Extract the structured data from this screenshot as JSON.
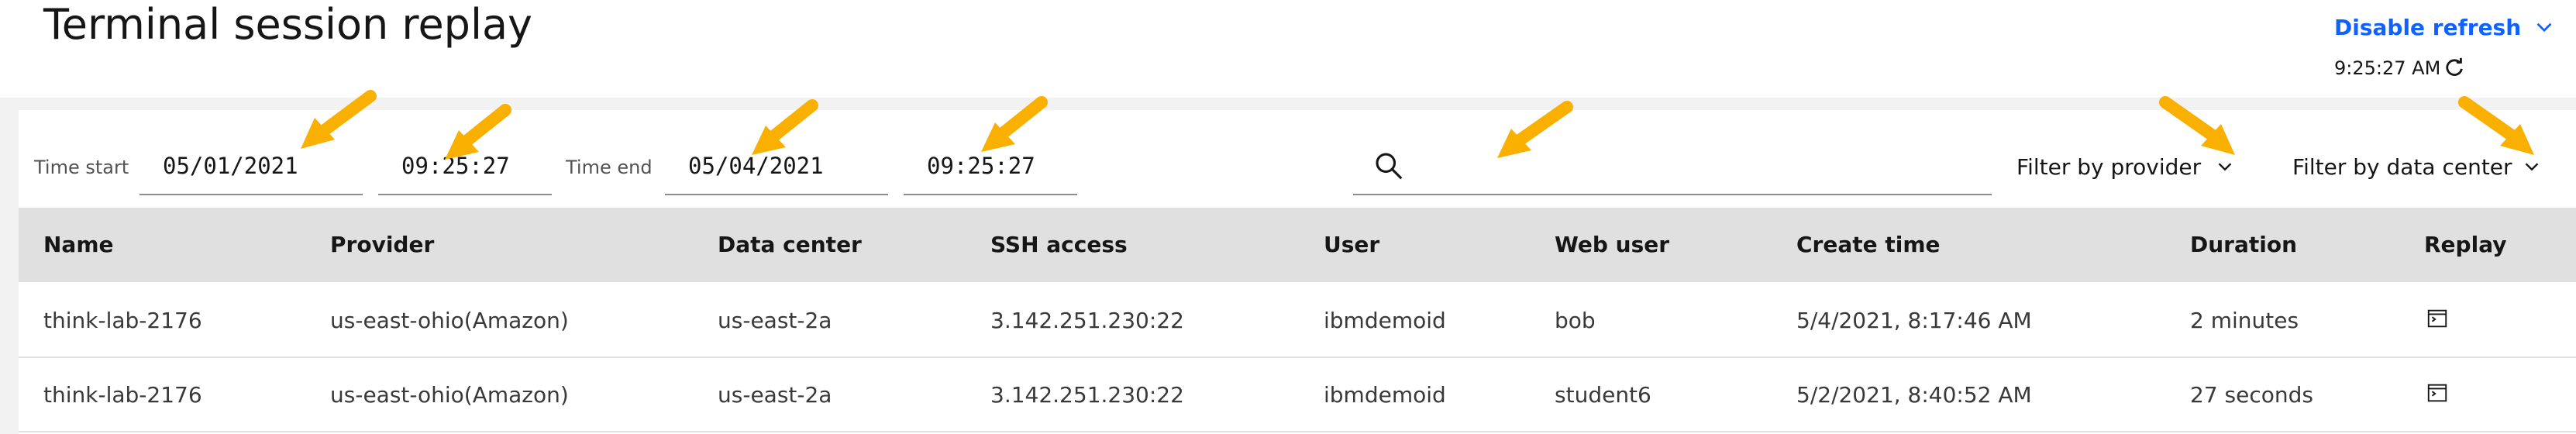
{
  "header": {
    "title": "Terminal session replay",
    "refresh_label": "Disable refresh",
    "last_refresh_time": "9:25:27 AM"
  },
  "filters": {
    "time_start_label": "Time start",
    "time_start_date": "05/01/2021",
    "time_start_time": "09:25:27",
    "time_end_label": "Time end",
    "time_end_date": "05/04/2021",
    "time_end_time": "09:25:27",
    "search_value": "",
    "provider_filter_label": "Filter by provider",
    "datacenter_filter_label": "Filter by data center"
  },
  "table": {
    "columns": [
      "Name",
      "Provider",
      "Data center",
      "SSH access",
      "User",
      "Web user",
      "Create time",
      "Duration",
      "Replay"
    ],
    "rows": [
      {
        "name": "think-lab-2176",
        "provider": "us-east-ohio(Amazon)",
        "data_center": "us-east-2a",
        "ssh_access": "3.142.251.230:22",
        "user": "ibmdemoid",
        "web_user": "bob",
        "create_time": "5/4/2021, 8:17:46 AM",
        "duration": "2 minutes",
        "replay_icon": "terminal-replay-icon"
      },
      {
        "name": "think-lab-2176",
        "provider": "us-east-ohio(Amazon)",
        "data_center": "us-east-2a",
        "ssh_access": "3.142.251.230:22",
        "user": "ibmdemoid",
        "web_user": "student6",
        "create_time": "5/2/2021, 8:40:52 AM",
        "duration": "27 seconds",
        "replay_icon": "terminal-replay-icon"
      }
    ]
  },
  "annotations": {
    "arrow_color": "#f9b000",
    "arrow_count": 7
  },
  "colors": {
    "accent": "#0f62fe",
    "header_bg": "#e0e0e0",
    "band_bg": "#f2f2f2"
  }
}
